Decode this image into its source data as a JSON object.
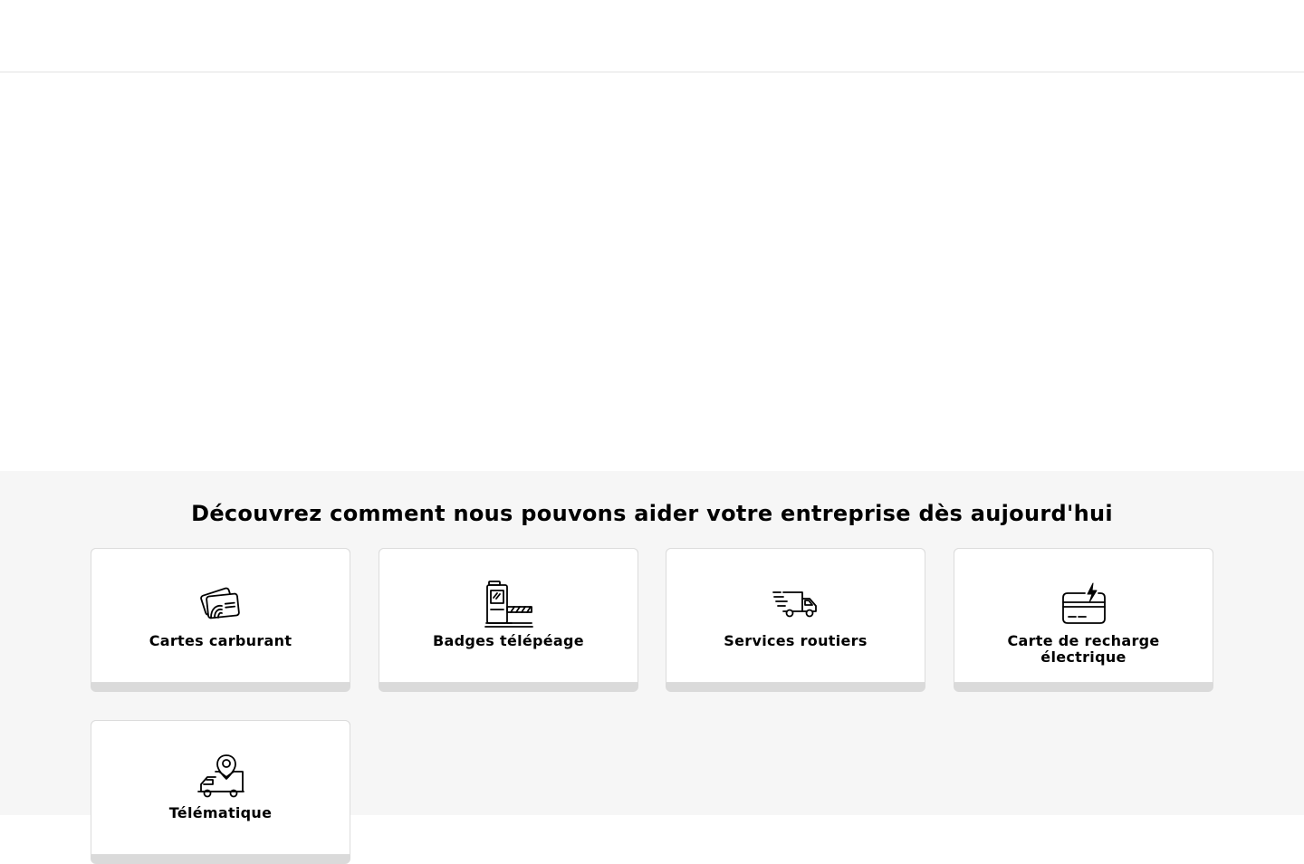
{
  "services": {
    "title": "Découvrez comment nous pouvons aider votre entreprise dès aujourd'hui",
    "cards": [
      {
        "label": "Cartes carburant",
        "icon": "fuel-cards-icon"
      },
      {
        "label": "Badges télépéage",
        "icon": "toll-gate-icon"
      },
      {
        "label": "Services routiers",
        "icon": "delivery-truck-icon"
      },
      {
        "label": "Carte de recharge électrique",
        "icon": "charging-card-icon"
      },
      {
        "label": "Télématique",
        "icon": "telematics-truck-icon"
      }
    ]
  }
}
